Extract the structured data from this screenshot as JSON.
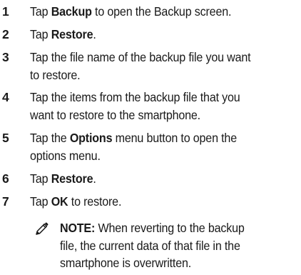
{
  "steps": [
    {
      "num": "1",
      "before": "Tap ",
      "bold": "Backup",
      "after": " to open the Backup screen."
    },
    {
      "num": "2",
      "before": "Tap ",
      "bold": "Restore",
      "after": "."
    },
    {
      "num": "3",
      "line1": "Tap the file name of the backup file you want",
      "line2": "to restore."
    },
    {
      "num": "4",
      "line1": "Tap the items from the backup file that you",
      "line2": "want to restore to the smartphone."
    },
    {
      "num": "5",
      "before": "Tap the ",
      "bold": "Options",
      "after": " menu button to open the",
      "line2": "options menu."
    },
    {
      "num": "6",
      "before": "Tap ",
      "bold": "Restore",
      "after": "."
    },
    {
      "num": "7",
      "before": "Tap ",
      "bold": "OK",
      "after": " to restore."
    }
  ],
  "note": {
    "icon": "pencil-note-icon",
    "label": "NOTE:",
    "line1_rest": " When reverting to the backup",
    "line2": "file, the current data of that file in the",
    "line3": "smartphone is overwritten."
  }
}
